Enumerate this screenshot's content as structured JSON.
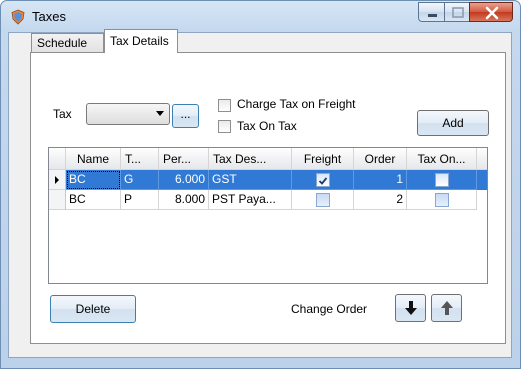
{
  "window": {
    "title": "Taxes",
    "accent": "#3079d5"
  },
  "tabs": [
    {
      "label": "Schedule",
      "active": false
    },
    {
      "label": "Tax Details",
      "active": true
    }
  ],
  "form": {
    "tax_label": "Tax",
    "tax_value": "",
    "ellipsis_label": "...",
    "charge_freight_label": "Charge Tax on Freight",
    "charge_freight_checked": false,
    "tax_on_tax_label": "Tax On Tax",
    "tax_on_tax_checked": false,
    "add_label": "Add"
  },
  "grid": {
    "columns": [
      "Name",
      "T...",
      "Per...",
      "Tax Des...",
      "Freight",
      "Order",
      "Tax On..."
    ],
    "rows": [
      {
        "name": "BC",
        "type": "G",
        "percent": "6.000",
        "description": "GST",
        "freight": true,
        "order": "1",
        "tax_on_tax": false,
        "selected": true
      },
      {
        "name": "BC",
        "type": "P",
        "percent": "8.000",
        "description": "PST Paya...",
        "freight": false,
        "order": "2",
        "tax_on_tax": false,
        "selected": false
      }
    ]
  },
  "footer": {
    "delete_label": "Delete",
    "change_order_label": "Change Order",
    "down_icon": "arrow-down-icon",
    "up_icon": "arrow-up-icon"
  }
}
